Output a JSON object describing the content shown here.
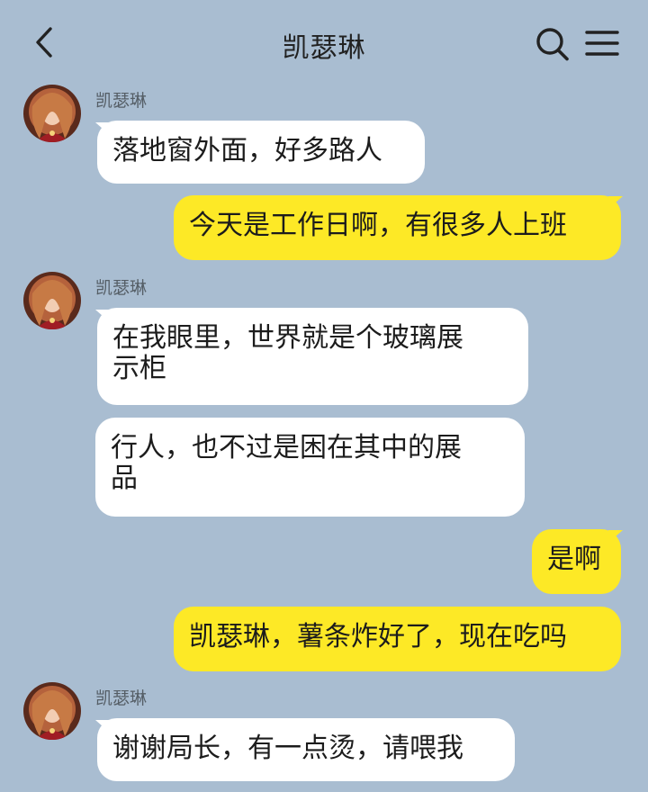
{
  "header": {
    "title": "凯瑟琳"
  },
  "colors": {
    "background": "#a9bdd1",
    "incoming_bubble": "#ffffff",
    "outgoing_bubble": "#fde926"
  },
  "icons": {
    "back": "chevron-left-icon",
    "search": "search-icon",
    "menu": "hamburger-menu-icon"
  },
  "messages": [
    {
      "sender": "凯瑟琳",
      "text": "落地窗外面，好多路人"
    },
    {
      "sender": "me",
      "text": "今天是工作日啊，有很多人上班"
    },
    {
      "sender": "凯瑟琳",
      "text": "在我眼里，世界就是个玻璃展\n示柜"
    },
    {
      "sender": "凯瑟琳",
      "text": "行人，也不过是困在其中的展\n品"
    },
    {
      "sender": "me",
      "text": "是啊"
    },
    {
      "sender": "me",
      "text": "凯瑟琳，薯条炸好了，现在吃吗"
    },
    {
      "sender": "凯瑟琳",
      "text": "谢谢局长，有一点烫，请喂我"
    }
  ]
}
